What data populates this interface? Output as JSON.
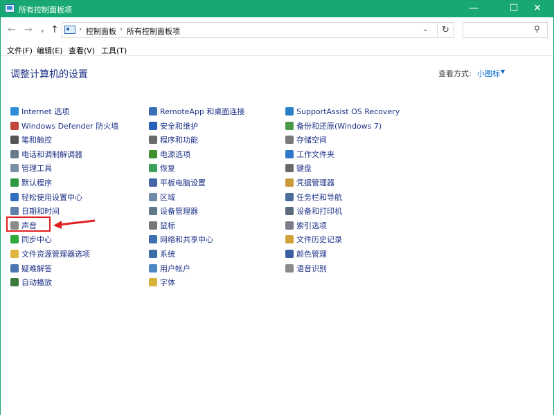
{
  "window": {
    "title": "所有控制面板项",
    "minimize": "—",
    "maximize": "☐",
    "close": "✕"
  },
  "nav": {
    "back_icon": "arrow-left-icon",
    "forward_icon": "arrow-right-icon",
    "recent_icon": "chevron-down-icon",
    "up_icon": "arrow-up-icon",
    "breadcrumbs": [
      "控制面板",
      "所有控制面板项"
    ],
    "refresh_icon": "refresh-icon",
    "search_placeholder": "",
    "search_icon": "search-icon"
  },
  "menu": [
    "文件(F)",
    "编辑(E)",
    "查看(V)",
    "工具(T)"
  ],
  "content": {
    "title": "调整计算机的设置",
    "viewby_label": "查看方式:",
    "viewby_value": "小图标"
  },
  "columns": [
    [
      {
        "label": "Internet 选项",
        "icon": "globe-icon",
        "color": "#2f8ed8"
      },
      {
        "label": "Windows Defender 防火墙",
        "icon": "firewall-icon",
        "color": "#c0463a"
      },
      {
        "label": "笔和触控",
        "icon": "pen-icon",
        "color": "#555555"
      },
      {
        "label": "电话和调制解调器",
        "icon": "fax-icon",
        "color": "#6a7c8c"
      },
      {
        "label": "管理工具",
        "icon": "admin-tools-icon",
        "color": "#7a8fa6"
      },
      {
        "label": "默认程序",
        "icon": "default-programs-icon",
        "color": "#2d9a43"
      },
      {
        "label": "轻松使用设置中心",
        "icon": "accessibility-icon",
        "color": "#2f6fc0"
      },
      {
        "label": "日期和时间",
        "icon": "clock-icon",
        "color": "#5d7fa8"
      },
      {
        "label": "声音",
        "icon": "speaker-icon",
        "color": "#8a8a8a"
      },
      {
        "label": "同步中心",
        "icon": "sync-icon",
        "color": "#2faa3a"
      },
      {
        "label": "文件资源管理器选项",
        "icon": "folder-options-icon",
        "color": "#e0b640"
      },
      {
        "label": "疑难解答",
        "icon": "troubleshoot-icon",
        "color": "#4a78b0"
      },
      {
        "label": "自动播放",
        "icon": "autoplay-icon",
        "color": "#3b7a3b"
      }
    ],
    [
      {
        "label": "RemoteApp 和桌面连接",
        "icon": "remoteapp-icon",
        "color": "#3a6fb6"
      },
      {
        "label": "安全和维护",
        "icon": "flag-icon",
        "color": "#2a5fb8"
      },
      {
        "label": "程序和功能",
        "icon": "programs-icon",
        "color": "#6b6b6b"
      },
      {
        "label": "电源选项",
        "icon": "power-icon",
        "color": "#3f8f2f"
      },
      {
        "label": "恢复",
        "icon": "recovery-icon",
        "color": "#3aa05a"
      },
      {
        "label": "平板电脑设置",
        "icon": "tablet-icon",
        "color": "#4466a8"
      },
      {
        "label": "区域",
        "icon": "region-icon",
        "color": "#6f8aa6"
      },
      {
        "label": "设备管理器",
        "icon": "device-manager-icon",
        "color": "#5f7a8a"
      },
      {
        "label": "鼠标",
        "icon": "mouse-icon",
        "color": "#777777"
      },
      {
        "label": "网络和共享中心",
        "icon": "network-icon",
        "color": "#3e70b0"
      },
      {
        "label": "系统",
        "icon": "system-icon",
        "color": "#3c6ea6"
      },
      {
        "label": "用户帐户",
        "icon": "user-accounts-icon",
        "color": "#4e88c4"
      },
      {
        "label": "字体",
        "icon": "fonts-icon",
        "color": "#d8b13a"
      }
    ],
    [
      {
        "label": "SupportAssist OS Recovery",
        "icon": "supportassist-icon",
        "color": "#2a7fc6"
      },
      {
        "label": "备份和还原(Windows 7)",
        "icon": "backup-icon",
        "color": "#4a9a4a"
      },
      {
        "label": "存储空间",
        "icon": "storage-icon",
        "color": "#7a7a7a"
      },
      {
        "label": "工作文件夹",
        "icon": "work-folders-icon",
        "color": "#2f78c8"
      },
      {
        "label": "键盘",
        "icon": "keyboard-icon",
        "color": "#6a6a6a"
      },
      {
        "label": "凭据管理器",
        "icon": "credential-icon",
        "color": "#c89a3a"
      },
      {
        "label": "任务栏和导航",
        "icon": "taskbar-icon",
        "color": "#4a6f9a"
      },
      {
        "label": "设备和打印机",
        "icon": "printer-icon",
        "color": "#5a6a7a"
      },
      {
        "label": "索引选项",
        "icon": "indexing-icon",
        "color": "#7a7a8a"
      },
      {
        "label": "文件历史记录",
        "icon": "file-history-icon",
        "color": "#d2a23a"
      },
      {
        "label": "颜色管理",
        "icon": "color-management-icon",
        "color": "#3a5fa0"
      },
      {
        "label": "语音识别",
        "icon": "microphone-icon",
        "color": "#8a8a8a"
      }
    ]
  ],
  "annotation": {
    "highlight_color": "#e02020",
    "highlighted_item": "声音"
  }
}
